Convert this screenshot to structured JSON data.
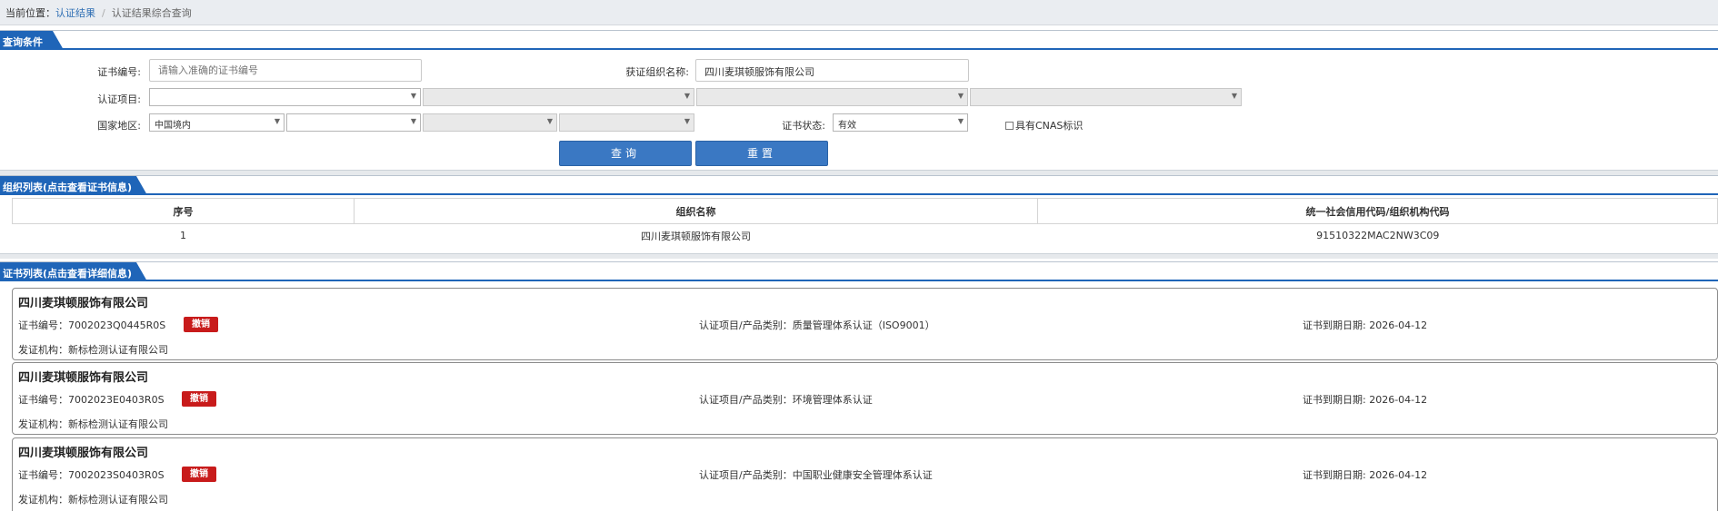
{
  "breadcrumb": {
    "prefix": "当前位置：",
    "link": "认证结果",
    "separator": "/",
    "current": "认证结果综合查询"
  },
  "query_section": {
    "title": "查询条件",
    "cert_no_label": "证书编号:",
    "cert_no_placeholder": "请输入准确的证书编号",
    "org_name_label": "获证组织名称:",
    "org_name_value": "四川麦琪顿服饰有限公司",
    "project_label": "认证项目:",
    "region_label": "国家地区:",
    "region_value": "中国境内",
    "status_label": "证书状态:",
    "status_value": "有效",
    "cnas_label": "具有CNAS标识",
    "search_button": "查询",
    "reset_button": "重置"
  },
  "org_section": {
    "title": "组织列表(点击查看证书信息)",
    "columns": [
      "序号",
      "组织名称",
      "统一社会信用代码/组织机构代码"
    ],
    "rows": [
      [
        "1",
        "四川麦琪顿服饰有限公司",
        "91510322MAC2NW3C09"
      ]
    ]
  },
  "cert_section": {
    "title": "证书列表(点击查看详细信息)",
    "cards": [
      {
        "org_name": "四川麦琪顿服饰有限公司",
        "cert_no": "证书编号：7002023Q0445R0S",
        "status": "撤销",
        "project": "认证项目/产品类别：质量管理体系认证（ISO9001）",
        "expiry": "证书到期日期: 2026-04-12",
        "issuer": "发证机构：新标检测认证有限公司"
      },
      {
        "org_name": "四川麦琪顿服饰有限公司",
        "cert_no": "证书编号：7002023E0403R0S",
        "status": "撤销",
        "project": "认证项目/产品类别：环境管理体系认证",
        "expiry": "证书到期日期: 2026-04-12",
        "issuer": "发证机构：新标检测认证有限公司"
      },
      {
        "org_name": "四川麦琪顿服饰有限公司",
        "cert_no": "证书编号：7002023S0403R0S",
        "status": "撤销",
        "project": "认证项目/产品类别：中国职业健康安全管理体系认证",
        "expiry": "证书到期日期: 2026-04-12",
        "issuer": "发证机构：新标检测认证有限公司"
      }
    ]
  },
  "colors": {
    "primary": "#1f65b8",
    "button": "#3a78c3",
    "badge": "#c81b1b"
  }
}
